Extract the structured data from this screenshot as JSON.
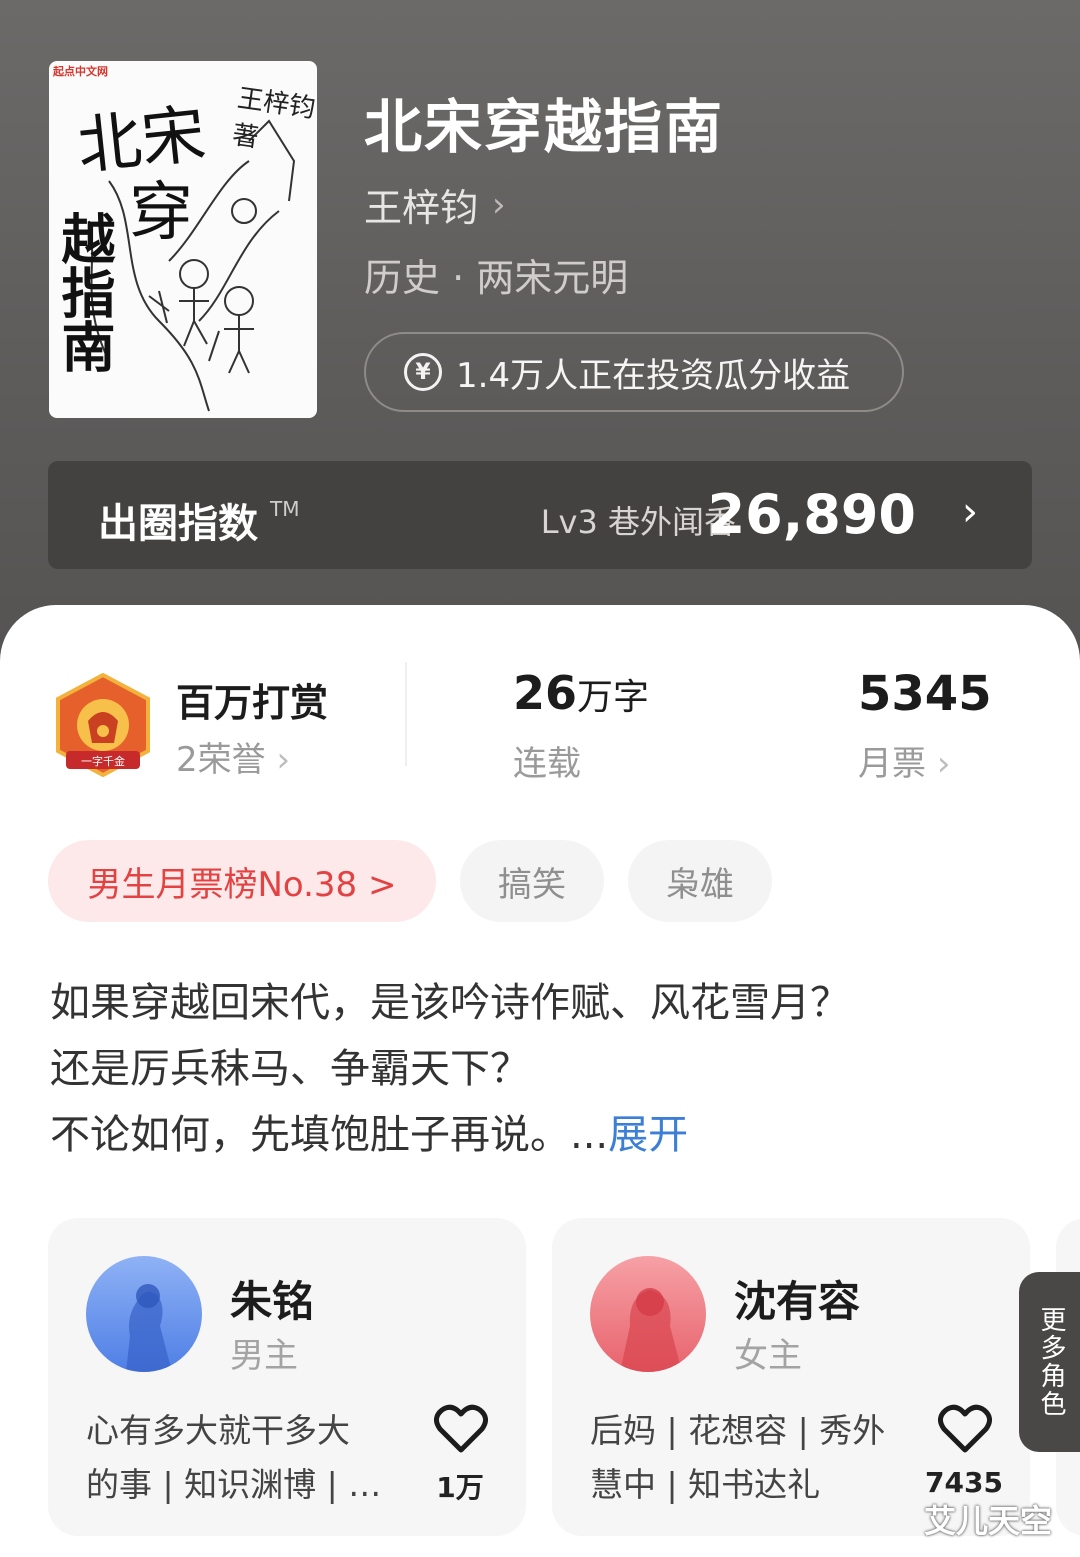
{
  "book": {
    "title": "北宋穿越指南",
    "author": "王梓钧",
    "genre": "历史 · 两宋元明",
    "invest_text": "1.4万人正在投资瓜分收益",
    "cover": {
      "brand": "起点中文网",
      "title_line1": "北宋",
      "title_line2": "穿",
      "title_line3": "越指南",
      "author_sign": "王梓钧著"
    }
  },
  "index": {
    "label": "出圈指数",
    "tm": "TM",
    "level": "Lv3 巷外闻香",
    "value": "26,890"
  },
  "stats": {
    "reward_title": "百万打赏",
    "reward_sub": "2荣誉",
    "badge_text": "一字千金",
    "words_num": "26",
    "words_unit": "万字",
    "words_sub": "连载",
    "votes": "5345",
    "votes_sub": "月票"
  },
  "tags": {
    "rank": "男生月票榜No.38 >",
    "tag1": "搞笑",
    "tag2": "枭雄"
  },
  "synopsis": {
    "line1": "如果穿越回宋代，是该吟诗作赋、风花雪月？",
    "line2": "还是厉兵秣马、争霸天下？",
    "line3": "不论如何，先填饱肚子再说。...",
    "expand": "展开"
  },
  "characters": [
    {
      "name": "朱铭",
      "role": "男主",
      "traits_line1": "心有多大就干多大",
      "traits_line2": "的事 | 知识渊博 | …",
      "likes": "1万"
    },
    {
      "name": "沈有容",
      "role": "女主",
      "traits_line1": "后妈 | 花想容 | 秀外",
      "traits_line2": "慧中 | 知书达礼",
      "likes": "7435"
    }
  ],
  "more_roles": "更多角色",
  "watermark": "艾儿天空",
  "colors": {
    "accent_red": "#e24242",
    "link_blue": "#3d7fd6"
  }
}
